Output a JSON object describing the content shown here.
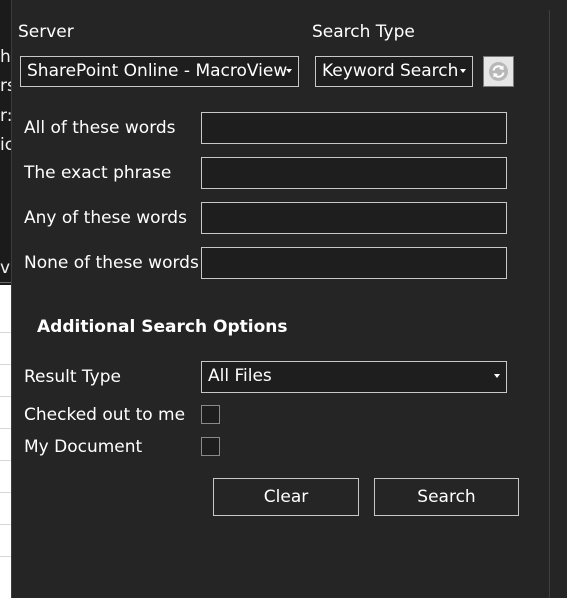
{
  "background_app": {
    "fragments": [
      "h",
      "rs",
      "r:",
      "ic",
      "vh"
    ]
  },
  "panel": {
    "server": {
      "label": "Server",
      "selected": "SharePoint Online - MacroView"
    },
    "search_type": {
      "label": "Search Type",
      "selected": "Keyword Search"
    },
    "refresh_icon": "refresh-icon",
    "fields": {
      "all_words": {
        "label": "All of these words",
        "value": ""
      },
      "exact_phrase": {
        "label": "The exact phrase",
        "value": ""
      },
      "any_words": {
        "label": "Any of these words",
        "value": ""
      },
      "none_words": {
        "label": "None of these words",
        "value": ""
      }
    },
    "additional_options": {
      "heading": "Additional Search Options",
      "result_type": {
        "label": "Result Type",
        "selected": "All Files"
      },
      "checked_out": {
        "label": "Checked out to me",
        "checked": false
      },
      "my_document": {
        "label": "My Document",
        "checked": false
      }
    },
    "buttons": {
      "clear": "Clear",
      "search": "Search"
    }
  },
  "colors": {
    "panel_bg": "#252526",
    "field_bg": "#1e1e1e",
    "border": "#c8c8c8",
    "text": "#ffffff"
  }
}
